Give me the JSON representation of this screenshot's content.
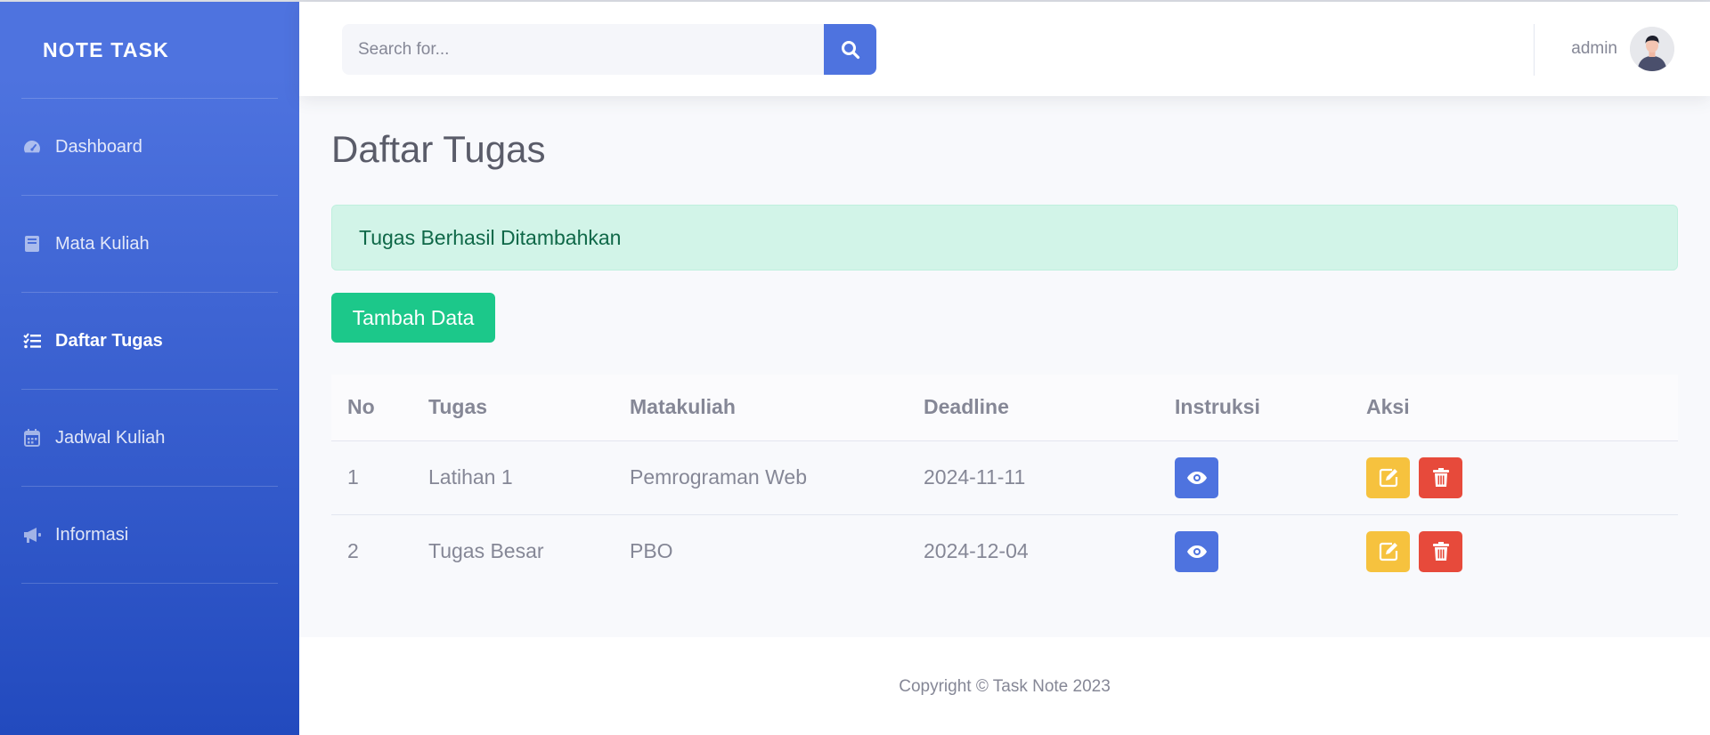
{
  "sidebar": {
    "brand": "NOTE TASK",
    "items": [
      {
        "label": "Dashboard",
        "icon": "tachometer-icon",
        "active": false
      },
      {
        "label": "Mata Kuliah",
        "icon": "book-icon",
        "active": false
      },
      {
        "label": "Daftar Tugas",
        "icon": "tasks-icon",
        "active": true
      },
      {
        "label": "Jadwal Kuliah",
        "icon": "calendar-icon",
        "active": false
      },
      {
        "label": "Informasi",
        "icon": "bullhorn-icon",
        "active": false
      }
    ]
  },
  "topbar": {
    "search_placeholder": "Search for...",
    "search_value": "",
    "user_name": "admin"
  },
  "main": {
    "title": "Daftar Tugas",
    "alert": "Tugas Berhasil Ditambahkan",
    "add_button": "Tambah Data",
    "table": {
      "headers": [
        "No",
        "Tugas",
        "Matakuliah",
        "Deadline",
        "Instruksi",
        "Aksi"
      ],
      "rows": [
        {
          "no": "1",
          "tugas": "Latihan 1",
          "matakuliah": "Pemrograman Web",
          "deadline": "2024-11-11"
        },
        {
          "no": "2",
          "tugas": "Tugas Besar",
          "matakuliah": "PBO",
          "deadline": "2024-12-04"
        }
      ]
    }
  },
  "footer": {
    "text": "Copyright © Task Note 2023"
  },
  "colors": {
    "primary": "#4e73df",
    "success": "#1cc88a",
    "warning": "#f6c23e",
    "danger": "#e74a3b"
  }
}
